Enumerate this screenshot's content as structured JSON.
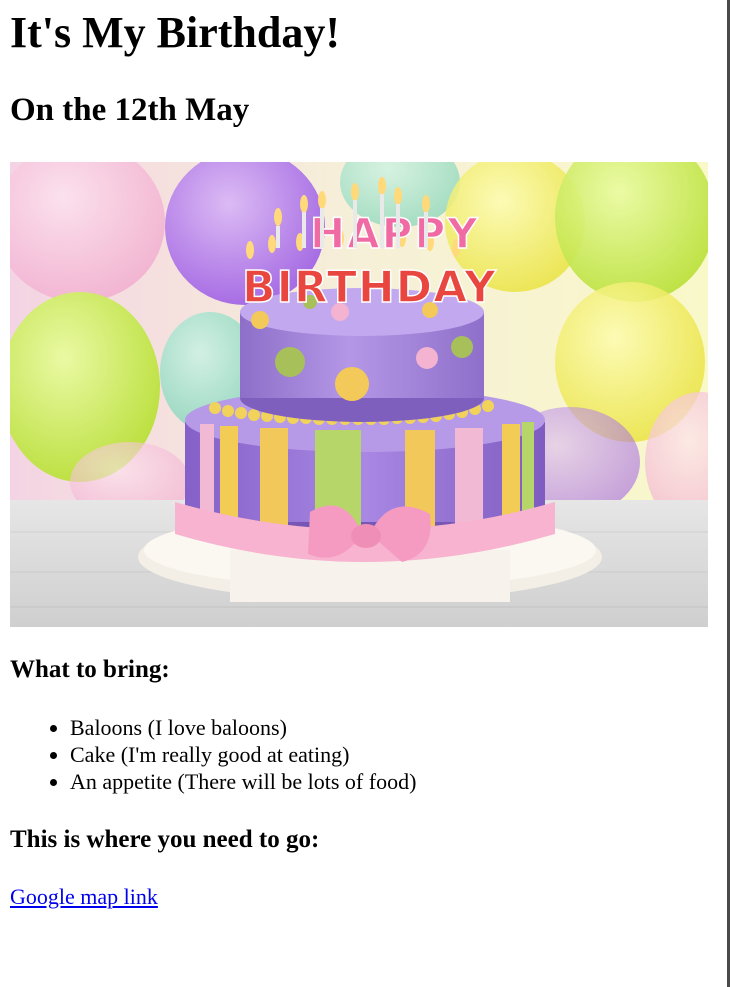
{
  "page": {
    "title": "It's My Birthday!",
    "date_heading": "On the 12th May"
  },
  "image": {
    "candle_letters_top": "HAPPY",
    "candle_letters_bottom": "BIRTHDAY"
  },
  "bring": {
    "heading": "What to bring:",
    "items": [
      "Baloons (I love baloons)",
      "Cake (I'm really good at eating)",
      "An appetite (There will be lots of food)"
    ]
  },
  "location": {
    "heading": "This is where you need to go:",
    "link_text": "Google map link"
  },
  "colors": {
    "link": "#0000ee",
    "text": "#000000",
    "background": "#ffffff"
  }
}
